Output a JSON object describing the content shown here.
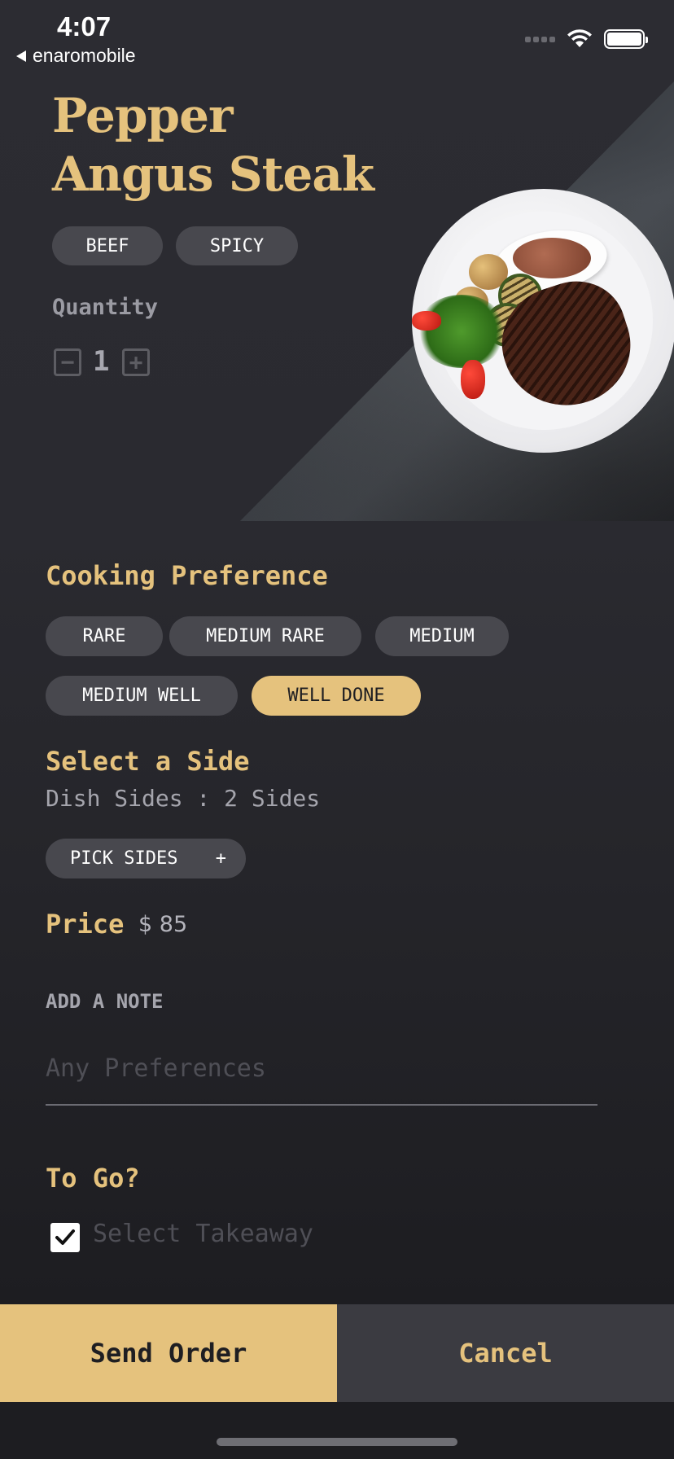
{
  "status_bar": {
    "time": "4:07",
    "back_app": "enaromobile"
  },
  "dish": {
    "title_line1": "Pepper",
    "title_line2": "Angus Steak",
    "tags": [
      "BEEF",
      "SPICY"
    ],
    "quantity_label": "Quantity",
    "quantity": "1",
    "image": "grilled-steak-plate-image"
  },
  "cooking": {
    "title": "Cooking Preference",
    "options": [
      "RARE",
      "MEDIUM RARE",
      "MEDIUM",
      "MEDIUM WELL",
      "WELL DONE"
    ],
    "selected": "WELL DONE"
  },
  "sides": {
    "title": "Select a Side",
    "subtitle": "Dish Sides : 2 Sides",
    "button_label": "PICK SIDES",
    "button_icon": "+"
  },
  "price": {
    "label": "Price",
    "value": "$ 85"
  },
  "note": {
    "label": "ADD A NOTE",
    "placeholder": "Any Preferences",
    "value": ""
  },
  "to_go": {
    "title": "To Go?",
    "checkbox_label": "Select Takeaway",
    "checked": true
  },
  "actions": {
    "send": "Send Order",
    "cancel": "Cancel"
  },
  "colors": {
    "accent": "#e5c27d",
    "background": "#2a2a30",
    "pill": "#48484e"
  }
}
